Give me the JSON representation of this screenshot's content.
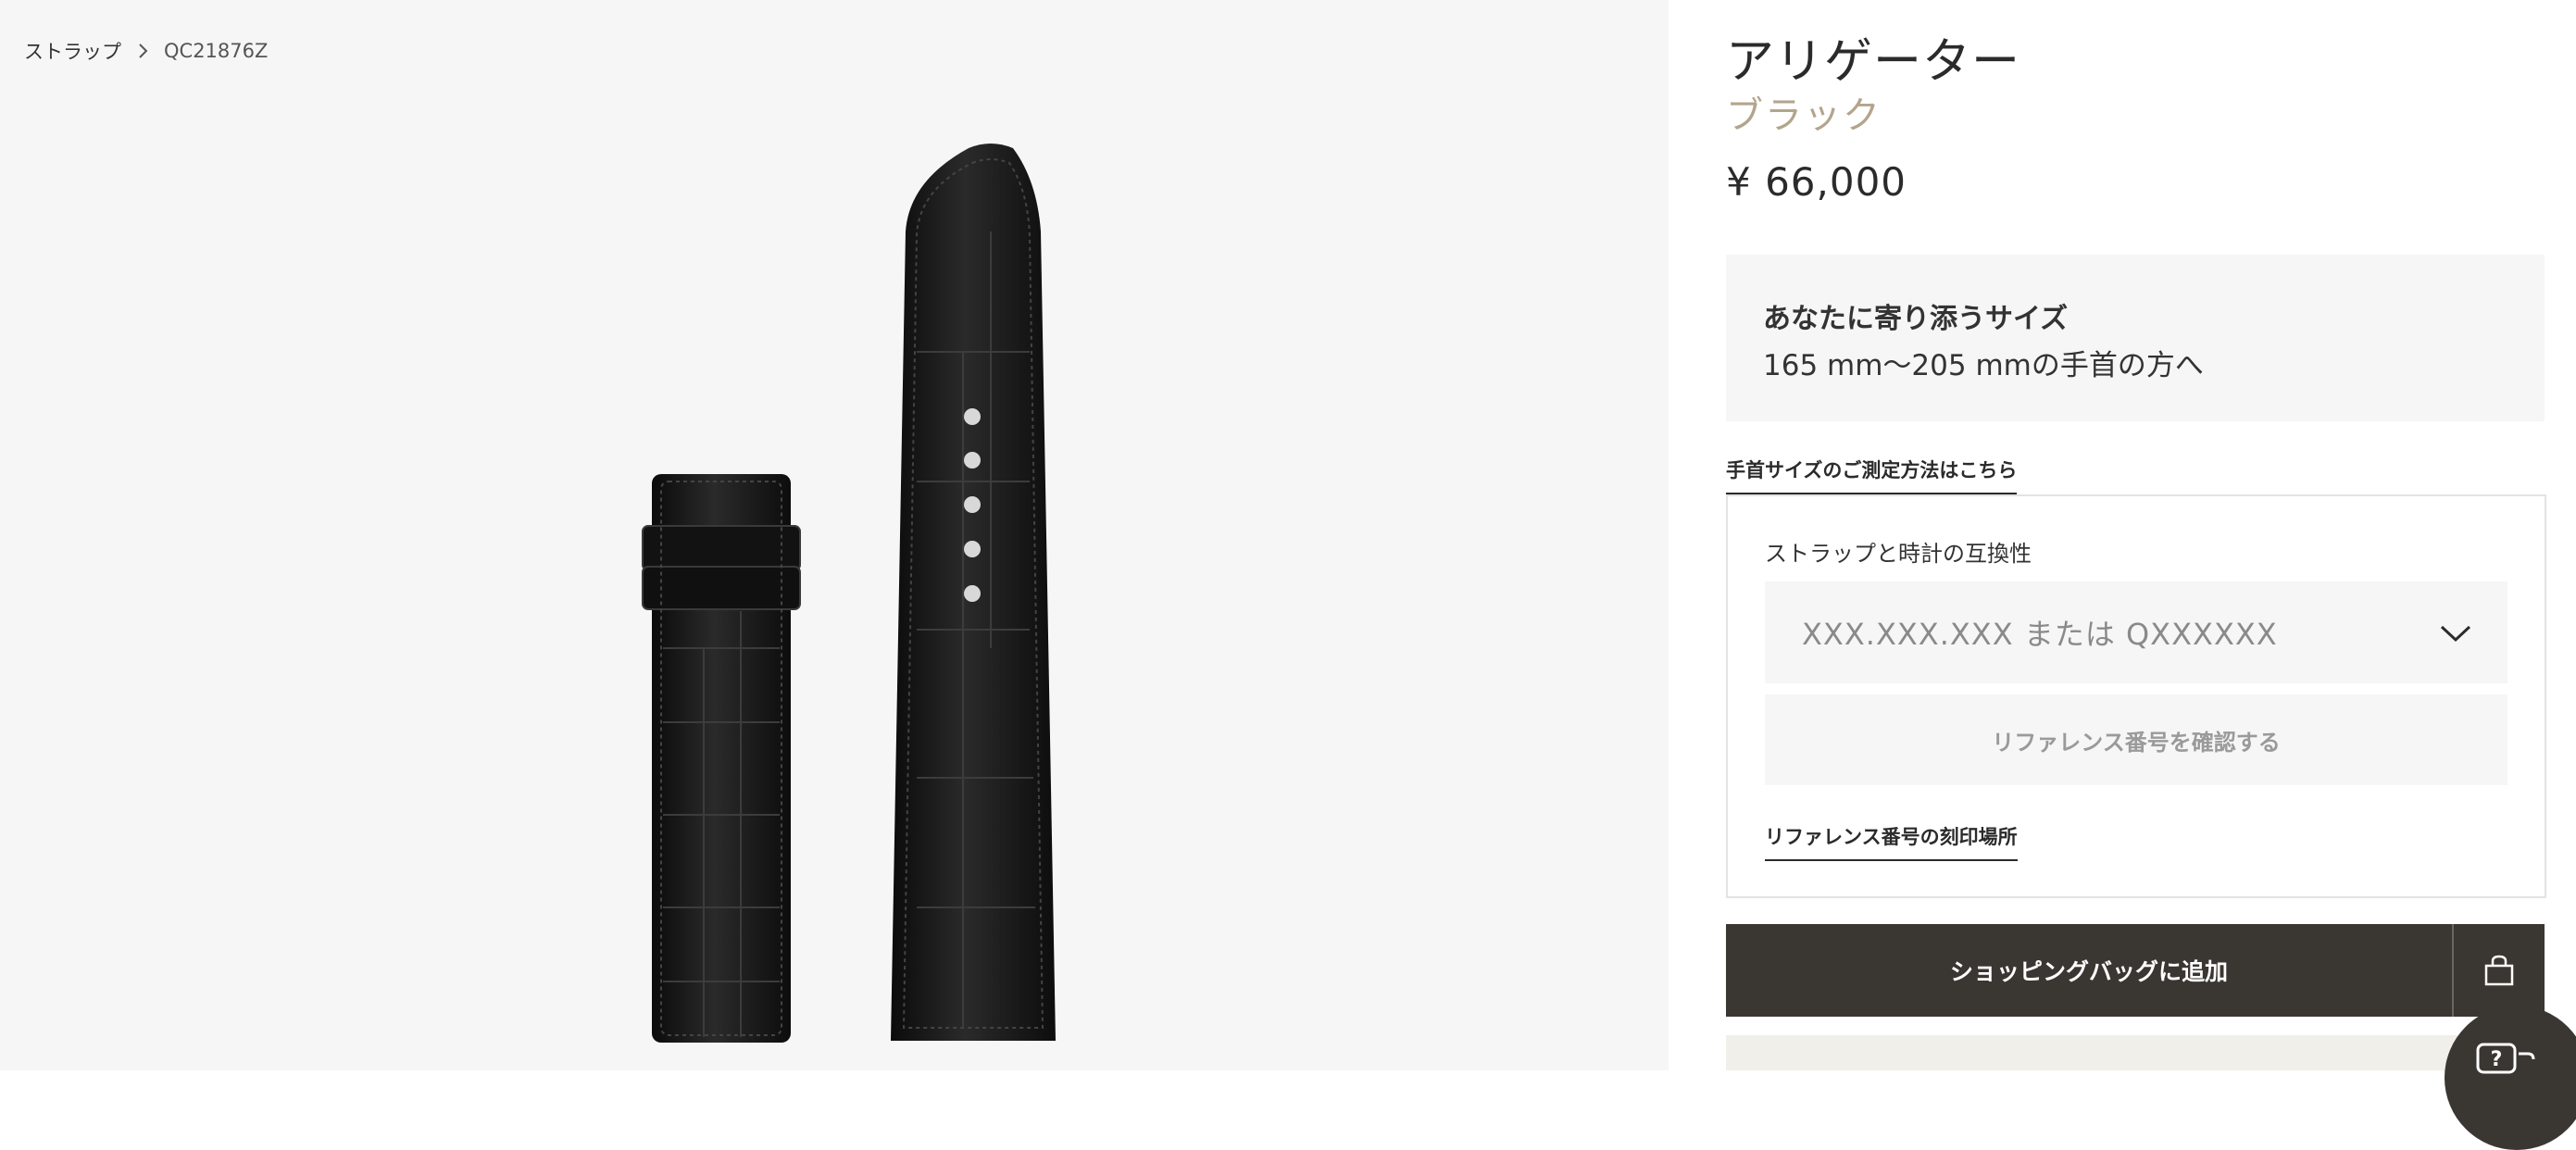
{
  "breadcrumb": {
    "parent": "ストラップ",
    "current": "QC21876Z"
  },
  "product": {
    "title": "アリゲーター",
    "color": "ブラック",
    "price": "¥ 66,000"
  },
  "fit": {
    "title": "あなたに寄り添うサイズ",
    "range": "165 mm〜205 mmの手首の方へ"
  },
  "links": {
    "measure": "手首サイズのご測定方法はこちら",
    "engraving_location": "リファレンス番号の刻印場所"
  },
  "compatibility": {
    "label": "ストラップと時計の互換性",
    "placeholder": "XXX.XXX.XXX または QXXXXXX",
    "confirm_label": "リファレンス番号を確認する"
  },
  "cart": {
    "add_label": "ショッピングバッグに追加"
  },
  "icons": {
    "breadcrumb_separator": "chevron-right-icon",
    "select": "chevron-down-icon",
    "bag": "shopping-bag-icon",
    "help": "help-chat-icon"
  },
  "colors": {
    "accent": "#b3a58d",
    "button_dark": "#3a3631",
    "panel_bg": "#f6f6f6"
  }
}
